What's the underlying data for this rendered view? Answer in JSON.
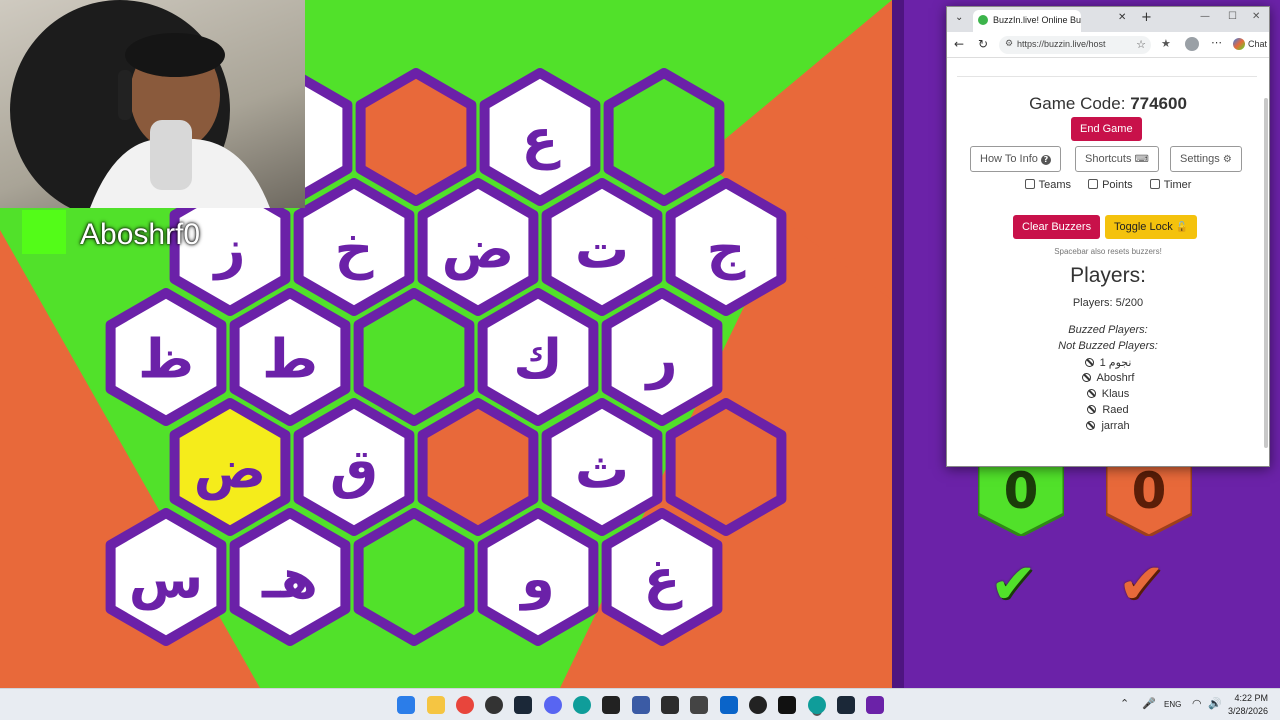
{
  "streamer": {
    "name": "Aboshrf0"
  },
  "board": {
    "colors": {
      "white": "#ffffff",
      "orange": "#e8693a",
      "green": "#51e12a",
      "yellow": "#f5ec1b",
      "purple": "#6b21a8",
      "letter": "#6b21a8"
    },
    "hexes": [
      {
        "row": 0,
        "col": 0,
        "fill": "white",
        "letter": ""
      },
      {
        "row": 0,
        "col": 1,
        "fill": "orange",
        "letter": ""
      },
      {
        "row": 0,
        "col": 2,
        "fill": "white",
        "letter": "ع"
      },
      {
        "row": 0,
        "col": 3,
        "fill": "green",
        "letter": ""
      },
      {
        "row": 1,
        "col": 0,
        "fill": "white",
        "letter": "ز"
      },
      {
        "row": 1,
        "col": 1,
        "fill": "white",
        "letter": "خ"
      },
      {
        "row": 1,
        "col": 2,
        "fill": "white",
        "letter": "ض"
      },
      {
        "row": 1,
        "col": 3,
        "fill": "white",
        "letter": "ت"
      },
      {
        "row": 1,
        "col": 4,
        "fill": "white",
        "letter": "ج"
      },
      {
        "row": 2,
        "col": 0,
        "fill": "white",
        "letter": "ظ"
      },
      {
        "row": 2,
        "col": 1,
        "fill": "white",
        "letter": "ط"
      },
      {
        "row": 2,
        "col": 2,
        "fill": "green",
        "letter": ""
      },
      {
        "row": 2,
        "col": 3,
        "fill": "white",
        "letter": "ك"
      },
      {
        "row": 2,
        "col": 4,
        "fill": "white",
        "letter": "ر"
      },
      {
        "row": 3,
        "col": 0,
        "fill": "yellow",
        "letter": "ض"
      },
      {
        "row": 3,
        "col": 1,
        "fill": "white",
        "letter": "ق"
      },
      {
        "row": 3,
        "col": 2,
        "fill": "orange",
        "letter": ""
      },
      {
        "row": 3,
        "col": 3,
        "fill": "white",
        "letter": "ث"
      },
      {
        "row": 3,
        "col": 4,
        "fill": "orange",
        "letter": ""
      },
      {
        "row": 4,
        "col": 0,
        "fill": "white",
        "letter": "س"
      },
      {
        "row": 4,
        "col": 1,
        "fill": "white",
        "letter": "هـ"
      },
      {
        "row": 4,
        "col": 2,
        "fill": "green",
        "letter": ""
      },
      {
        "row": 4,
        "col": 3,
        "fill": "white",
        "letter": "و"
      },
      {
        "row": 4,
        "col": 4,
        "fill": "white",
        "letter": "غ"
      }
    ]
  },
  "scores": {
    "green": {
      "value": "0",
      "color": "#51e12a"
    },
    "orange": {
      "value": "0",
      "color": "#e8693a"
    }
  },
  "browser": {
    "tab_title": "BuzzIn.live! Online Buzzer System",
    "url": "https://buzzin.live/host",
    "chat_label": "Chat"
  },
  "host": {
    "game_code_label": "Game Code:",
    "game_code": "774600",
    "end_game": "End Game",
    "how_to_info": "How To Info",
    "shortcuts": "Shortcuts",
    "settings": "Settings",
    "teams": "Teams",
    "points": "Points",
    "timer": "Timer",
    "clear_buzzers": "Clear Buzzers",
    "toggle_lock": "Toggle Lock",
    "spacebar_hint": "Spacebar also resets buzzers!",
    "players_heading": "Players:",
    "players_count": "Players: 5/200",
    "buzzed_label": "Buzzed Players:",
    "not_buzzed_label": "Not Buzzed Players:",
    "not_buzzed_players": [
      "نجوم 1",
      "Aboshrf",
      "Klaus",
      "Raed",
      "jarrah"
    ]
  },
  "taskbar": {
    "lang": "ENG",
    "time": "4:22 PM",
    "date": "3/28/2026"
  }
}
